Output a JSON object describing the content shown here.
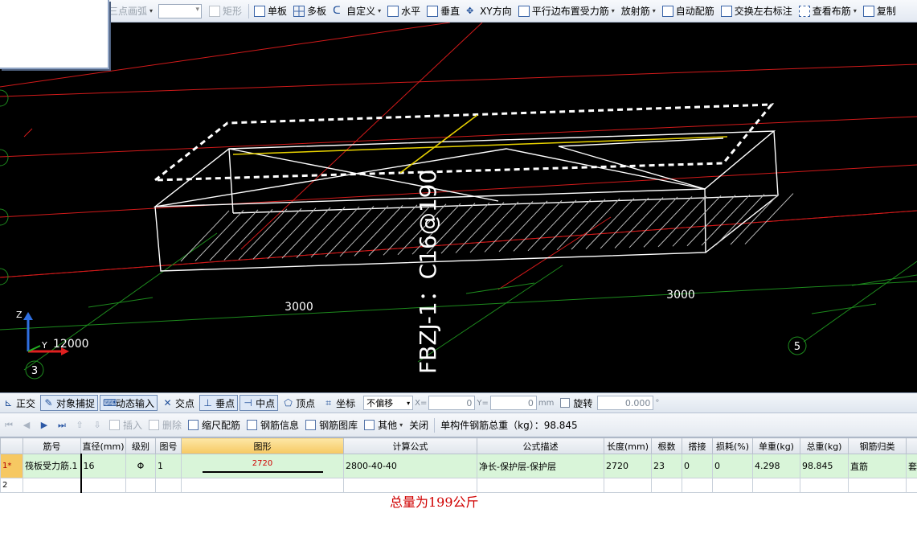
{
  "top_toolbar": {
    "items": [
      {
        "label": "三点画弧",
        "icon": "arc-icon",
        "disabled": true,
        "dropdown": true
      },
      {
        "label": "矩形",
        "icon": "rectangle-icon",
        "disabled": true
      },
      {
        "label": "单板",
        "icon": "single-slab-icon"
      },
      {
        "label": "多板",
        "icon": "multi-slab-icon"
      },
      {
        "label": "自定义",
        "icon": "custom-icon",
        "dropdown": true
      },
      {
        "label": "水平",
        "icon": "horizontal-icon"
      },
      {
        "label": "垂直",
        "icon": "vertical-icon"
      },
      {
        "label": "XY方向",
        "icon": "xy-direction-icon"
      },
      {
        "label": "平行边布置受力筋",
        "icon": "parallel-edge-icon",
        "dropdown": true
      },
      {
        "label": "放射筋",
        "icon": "radial-icon",
        "dropdown": true
      },
      {
        "label": "自动配筋",
        "icon": "auto-rebar-icon"
      },
      {
        "label": "交换左右标注",
        "icon": "swap-label-icon"
      },
      {
        "label": "查看布筋",
        "icon": "view-rebar-icon",
        "dropdown": true
      },
      {
        "label": "复制",
        "icon": "copy-icon"
      }
    ]
  },
  "viewport": {
    "dim_left": "3000",
    "dim_right": "3000",
    "dim_axis": "12000",
    "rebar_label": "FBZJ-1：C16@190",
    "axis_marker_3": "3",
    "axis_marker_5": "5",
    "axis_z": "Z",
    "axis_y": "Y"
  },
  "snap_toolbar": {
    "ortho": "正交",
    "object_snap": "对象捕捉",
    "dynamic_input": "动态输入",
    "intersection": "交点",
    "perpendicular": "垂点",
    "midpoint": "中点",
    "vertex": "顶点",
    "coordinate": "坐标",
    "offset_mode": "不偏移",
    "x_label": "X=",
    "x_value": "0",
    "y_label": "Y=",
    "y_value": "0",
    "unit_mm": "mm",
    "rotate": "旋转",
    "rotate_value": "0.000",
    "degree": "°"
  },
  "rebar_toolbar": {
    "insert": "插入",
    "delete": "删除",
    "scale_rebar": "缩尺配筋",
    "rebar_info": "钢筋信息",
    "rebar_library": "钢筋图库",
    "other": "其他",
    "close": "关闭",
    "total_weight": "单构件钢筋总重（kg）：98.845"
  },
  "table": {
    "headers": [
      "",
      "筋号",
      "直径(mm)",
      "级别",
      "图号",
      "图形",
      "计算公式",
      "公式描述",
      "长度(mm)",
      "根数",
      "搭接",
      "损耗(%)",
      "单重(kg)",
      "总重(kg)",
      "钢筋归类",
      ""
    ],
    "row1": {
      "index": "1*",
      "name": "筏板受力筋.1",
      "diameter": "16",
      "grade": "Φ",
      "figure_no": "1",
      "shape_dim": "2720",
      "formula": "2800-40-40",
      "description": "净长-保护层-保护层",
      "length": "2720",
      "count": "23",
      "lap": "0",
      "loss": "0",
      "unit_weight": "4.298",
      "total_weight": "98.845",
      "category": "直筋",
      "extra": "套"
    },
    "row2": {
      "index": "2"
    }
  },
  "annotation": {
    "total_note": "总量为199公斤"
  }
}
